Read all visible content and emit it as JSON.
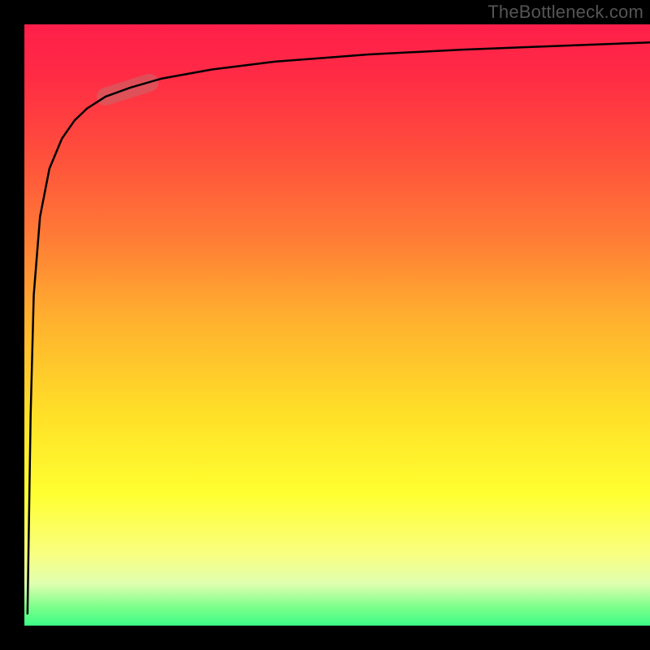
{
  "watermark": "TheBottleneck.com",
  "colors": {
    "highlight": "#c46a6a",
    "curve": "#000000"
  },
  "chart_data": {
    "type": "line",
    "title": "",
    "xlabel": "",
    "ylabel": "",
    "xlim": [
      0,
      100
    ],
    "ylim": [
      0,
      100
    ],
    "grid": false,
    "series": [
      {
        "name": "curve",
        "x": [
          0.5,
          1.0,
          1.5,
          2.5,
          4,
          6,
          8,
          10,
          13,
          17,
          22,
          30,
          40,
          55,
          70,
          85,
          100
        ],
        "y": [
          2,
          35,
          55,
          68,
          76,
          81,
          84,
          86,
          88,
          89.5,
          91,
          92.5,
          93.8,
          95,
          95.8,
          96.4,
          97
        ]
      }
    ],
    "highlight_segment": {
      "x": [
        13,
        20
      ],
      "y": [
        88,
        90.3
      ]
    },
    "annotations": []
  }
}
